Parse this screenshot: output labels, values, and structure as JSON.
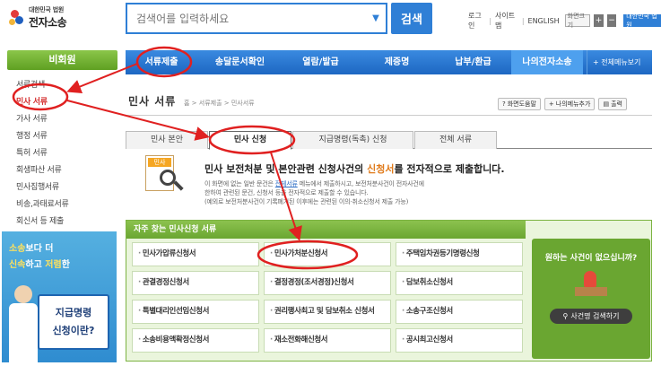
{
  "header": {
    "logo_line1": "대한민국 법원",
    "logo_line2": "전자소송",
    "search_placeholder": "검색어를 입력하세요",
    "search_button": "검색",
    "links": [
      "로그인",
      "사이트맵",
      "ENGLISH"
    ],
    "font_size_label": "화면크기",
    "court_button": "대한민국 법원"
  },
  "sidebar": {
    "title": "비회원",
    "items": [
      "서류검색",
      "민사 서류",
      "가사 서류",
      "행정 서류",
      "특허 서류",
      "회생파산 서류",
      "민사집행서류",
      "비송,과태료서류",
      "회신서 등 제출"
    ],
    "active_index": 1
  },
  "banner": {
    "line1_a": "소송",
    "line1_b": "보다 더",
    "line2_a": "신속",
    "line2_b": "하고",
    "line2_c": "저렴",
    "line2_d": "한",
    "sign1": "지급명령",
    "sign2": "신청이란?"
  },
  "nav": {
    "items": [
      "서류제출",
      "송달문서확인",
      "열람/발급",
      "제증명",
      "납부/환급",
      "나의전자소송"
    ],
    "active_index": 5,
    "more": "+ 전체메뉴보기"
  },
  "title": {
    "text": "민사 서류",
    "breadcrumb": "홈 > 서류제출 > 민사서류",
    "tools": [
      "화면도움말",
      "나의메뉴추가",
      "출력"
    ]
  },
  "tabs": [
    "민사 본안",
    "민사 신청",
    "지급명령(독촉) 신청",
    "전체 서류"
  ],
  "tabs_active": 1,
  "info": {
    "head_pre": "민사 보전처분 및 본안관련 신청사건의 ",
    "head_hl": "신청서",
    "head_post": "를 전자적으로 제출합니다.",
    "line1_pre": "이 화면에 없는 일반 문건은 ",
    "line1_link": "전체서류",
    "line1_post": " 메뉴에서 제출하시고, 보전처분사건이 전자사건에",
    "line2": "한하여 관련된 문건, 신청서 등을 전자적으로 제출할 수 있습니다.",
    "line3": "(예외로 보전처분사건이 기록폐기된 이후에는 관련된 이의·취소신청서 제출 가능)"
  },
  "frequent": {
    "title": "자주 찾는 민사신청 서류",
    "items": [
      "민사가압류신청서",
      "민사가처분신청서",
      "주택임차권등기명령신청",
      "관결경정신청서",
      "결정경정(조서경정)신청서",
      "담보취소신청서",
      "특별대리인선임신청서",
      "권리행사최고 및 담보취소 신청서",
      "소송구조신청서",
      "소송비용액확정신청서",
      "재소전화해신청서",
      "공시최고신청서"
    ],
    "right_question": "원하는 사건이 없으십니까?",
    "right_button": "사건명 검색하기"
  },
  "colors": {
    "nav_blue": "#1d67c2",
    "green": "#6aa631",
    "annotation_red": "#e02020"
  }
}
